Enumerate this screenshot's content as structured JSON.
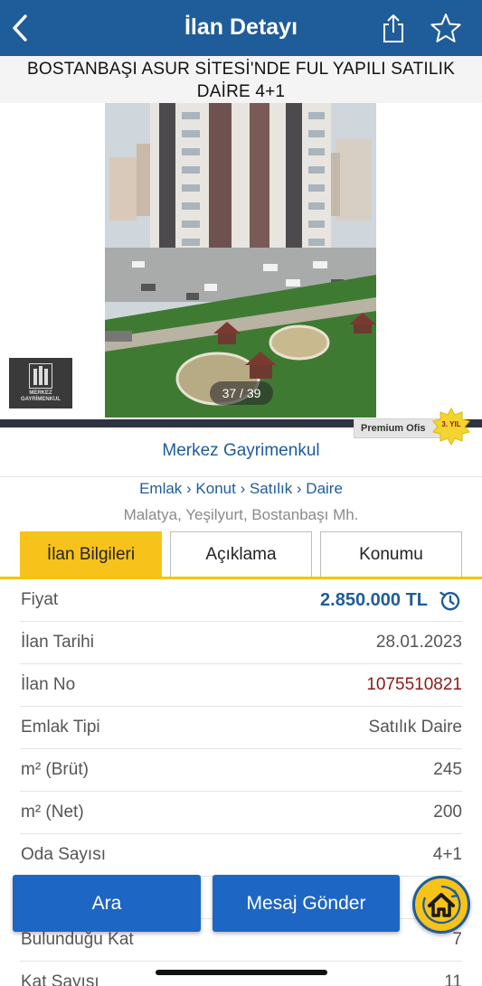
{
  "navbar": {
    "title": "İlan Detayı"
  },
  "listing": {
    "title": "BOSTANBAŞI ASUR SİTESİ'NDE FUL YAPILI SATILIK DAİRE 4+1",
    "photo_counter": "37 / 39",
    "logo_text": "MERKEZ GAYRİMENKUL"
  },
  "office": {
    "premium_label": "Premium Ofis",
    "year_label": "3. YIL",
    "name": "Merkez Gayrimenkul"
  },
  "breadcrumb": "Emlak › Konut › Satılık › Daire",
  "location": "Malatya, Yeşilyurt, Bostanbaşı Mh.",
  "tabs": [
    {
      "label": "İlan Bilgileri"
    },
    {
      "label": "Açıklama"
    },
    {
      "label": "Konumu"
    }
  ],
  "info_rows": [
    {
      "label": "Fiyat",
      "value": "2.850.000 TL"
    },
    {
      "label": "İlan Tarihi",
      "value": "28.01.2023"
    },
    {
      "label": "İlan No",
      "value": "1075510821"
    },
    {
      "label": "Emlak Tipi",
      "value": "Satılık Daire"
    },
    {
      "label": "m² (Brüt)",
      "value": "245"
    },
    {
      "label": "m² (Net)",
      "value": "200"
    },
    {
      "label": "Oda Sayısı",
      "value": "4+1"
    },
    {
      "label": "",
      "value": ""
    },
    {
      "label": "Bulunduğu Kat",
      "value": "7"
    },
    {
      "label": "Kat Sayısı",
      "value": "11"
    }
  ],
  "actions": {
    "call_label": "Ara",
    "message_label": "Mesaj Gönder"
  },
  "colors": {
    "brand_blue": "#1f5c9a",
    "accent_yellow": "#f7c31a",
    "button_blue": "#1e66c3"
  }
}
